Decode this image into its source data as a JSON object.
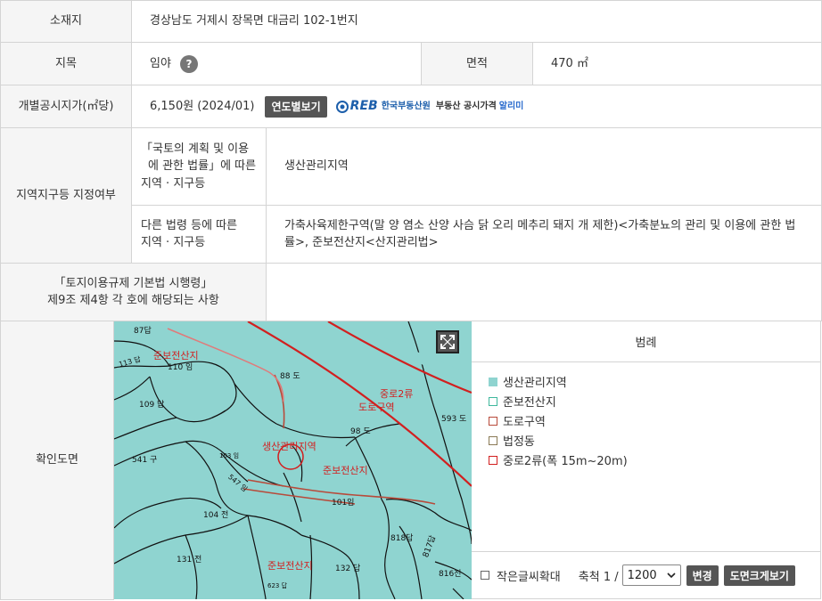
{
  "rows": {
    "location": {
      "label": "소재지",
      "value": "경상남도 거제시 장목면 대금리 102-1번지"
    },
    "jimok": {
      "label": "지목",
      "value": "임야",
      "help_icon": "question-mark-icon"
    },
    "area": {
      "label": "면적",
      "value": "470 ㎡"
    },
    "price": {
      "label": "개별공시지가(㎡당)",
      "value": "6,150원 (2024/01)",
      "yearly_button": "연도별보기",
      "logo_mark": "R",
      "logo_text_reb": "EB",
      "logo_org": "한국부동산원",
      "logo_service": "부동산 공시가격",
      "logo_alimi": "알리미"
    },
    "zone": {
      "label": "지역지구등 지정여부",
      "national_label_1": "「국토의 계획 및 이용",
      "national_label_2": "에 관한 법률」에 따른",
      "national_label_3": "지역 · 지구등",
      "national_value": "생산관리지역",
      "other_label_1": "다른 법령 등에 따른",
      "other_label_2": "지역 · 지구등",
      "other_value": "가축사육제한구역(말 양 염소 산양 사슴 닭 오리 메추리 돼지 개 제한)<가축분뇨의 관리 및 이용에 관한 법률>, 준보전산지<산지관리법>"
    },
    "enforcement": {
      "label_1": "「토지이용규제 기본법 시행령」",
      "label_2": "제9조 제4항 각 호에 해당되는 사항",
      "value": ""
    },
    "map": {
      "label": "확인도면"
    }
  },
  "map": {
    "parcels": [
      "87답",
      "113 답",
      "110 임",
      "88 도",
      "109 답",
      "593 도",
      "98 도",
      "541 구",
      "103 임",
      "547 임",
      "101임",
      "104 전",
      "818답",
      "817답",
      "131 전",
      "132 답",
      "816전",
      "623 답"
    ],
    "zones": [
      "준보전산지",
      "중로2류",
      "도로구역",
      "생산관리지역",
      "준보전산지",
      "준보전산지"
    ]
  },
  "legend": {
    "title": "범례",
    "items": [
      {
        "label": "생산관리지역",
        "color": "#8fd4d0"
      },
      {
        "label": "준보전산지",
        "color": "#3fb89d"
      },
      {
        "label": "도로구역",
        "color": "#b84a3a"
      },
      {
        "label": "법정동",
        "color": "#8a7a55"
      },
      {
        "label": "중로2류(폭 15m~20m)",
        "color": "#d21f1f"
      }
    ]
  },
  "footer": {
    "small_text_label": "작은글씨확대",
    "scale_label": "축척 1 /",
    "scale_value": "1200",
    "apply_button": "변경",
    "enlarge_button": "도면크게보기"
  }
}
